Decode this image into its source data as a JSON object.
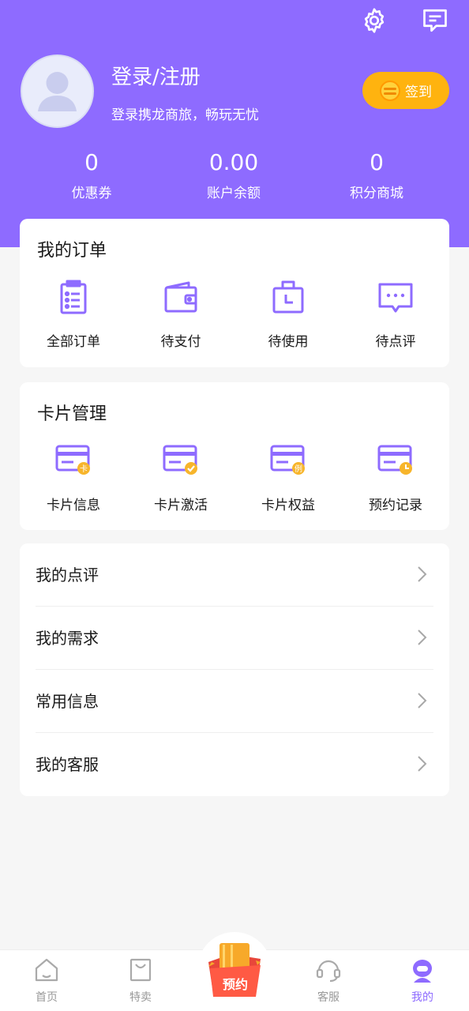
{
  "header": {
    "login_title": "登录/注册",
    "login_subtitle": "登录携龙商旅，畅玩无忧",
    "checkin_label": "签到",
    "colors": {
      "primary": "#8e6bff",
      "checkin": "#ffb30f"
    }
  },
  "stats": [
    {
      "value": "0",
      "label": "优惠券"
    },
    {
      "value": "0.00",
      "label": "账户余额"
    },
    {
      "value": "0",
      "label": "积分商城"
    }
  ],
  "orders": {
    "title": "我的订单",
    "items": [
      {
        "label": "全部订单",
        "icon": "clipboard-list-icon"
      },
      {
        "label": "待支付",
        "icon": "wallet-icon"
      },
      {
        "label": "待使用",
        "icon": "briefcase-clock-icon"
      },
      {
        "label": "待点评",
        "icon": "chat-bubble-icon"
      }
    ]
  },
  "cards": {
    "title": "卡片管理",
    "items": [
      {
        "label": "卡片信息",
        "icon": "card-info-icon",
        "badge": "卡"
      },
      {
        "label": "卡片激活",
        "icon": "card-activate-icon",
        "badge": "✓"
      },
      {
        "label": "卡片权益",
        "icon": "card-rights-icon",
        "badge": "例"
      },
      {
        "label": "预约记录",
        "icon": "card-booking-icon",
        "badge": "◷"
      }
    ]
  },
  "menu": [
    {
      "label": "我的点评"
    },
    {
      "label": "我的需求"
    },
    {
      "label": "常用信息"
    },
    {
      "label": "我的客服"
    }
  ],
  "tabbar": {
    "items": [
      {
        "label": "首页",
        "icon": "home-icon"
      },
      {
        "label": "特卖",
        "icon": "shopping-bag-icon"
      },
      {
        "label": "客服",
        "icon": "headset-icon"
      },
      {
        "label": "我的",
        "icon": "profile-icon"
      }
    ],
    "center_label": "预约",
    "active": "我的"
  }
}
